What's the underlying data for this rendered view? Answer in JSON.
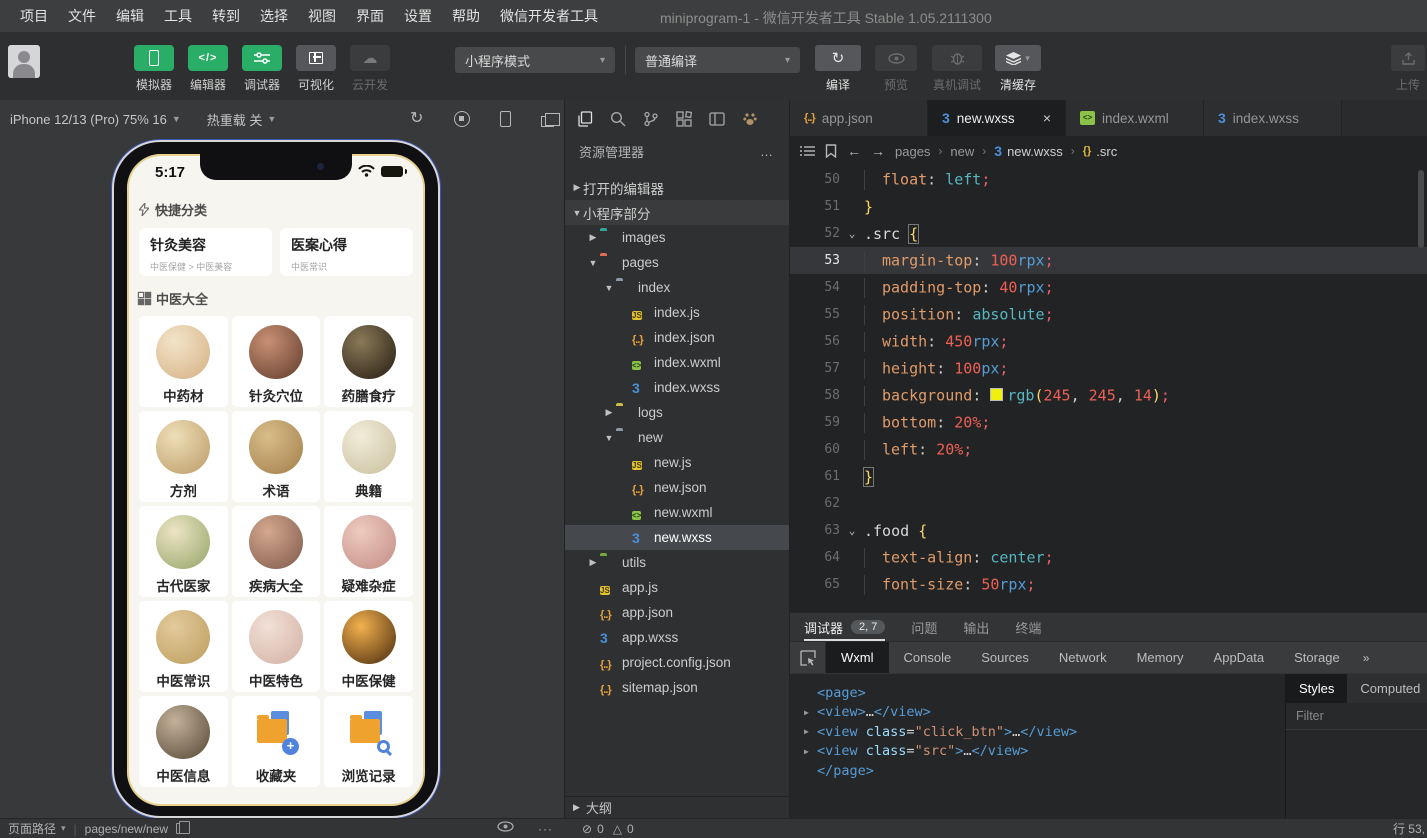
{
  "menu_bar": {
    "items": [
      "项目",
      "文件",
      "编辑",
      "工具",
      "转到",
      "选择",
      "视图",
      "界面",
      "设置",
      "帮助",
      "微信开发者工具"
    ],
    "title": "miniprogram-1 - 微信开发者工具 Stable 1.05.2111300"
  },
  "toolbar": {
    "mode_buttons": [
      {
        "label": "模拟器",
        "icon": "phone-icon",
        "state": "on"
      },
      {
        "label": "编辑器",
        "icon": "code-icon",
        "state": "on"
      },
      {
        "label": "调试器",
        "icon": "sliders-icon",
        "state": "on"
      },
      {
        "label": "可视化",
        "icon": "layout-icon",
        "state": "neutral"
      },
      {
        "label": "云开发",
        "icon": "cloud-icon",
        "state": "disabled"
      }
    ],
    "mode_select": "小程序模式",
    "compile_select": "普通编译",
    "actions": [
      {
        "label": "编译",
        "icon": "refresh-icon",
        "state": "normal"
      },
      {
        "label": "预览",
        "icon": "eye-icon",
        "state": "disabled"
      },
      {
        "label": "真机调试",
        "icon": "bug-icon",
        "state": "disabled"
      },
      {
        "label": "清缓存",
        "icon": "layers-icon",
        "state": "normal"
      }
    ],
    "upload_label": "上传",
    "accent_green": "#2aae67"
  },
  "simulator": {
    "device": "iPhone 12/13 (Pro) 75% 16",
    "hot_reload": "热重载 关",
    "phone": {
      "time": "5:17",
      "section1_title": "快捷分类",
      "quick_cards": [
        {
          "title": "针灸美容",
          "subtitle": "中医保健 > 中医美容"
        },
        {
          "title": "医案心得",
          "subtitle": "中医常识"
        }
      ],
      "section2_title": "中医大全",
      "grid": [
        {
          "label": "中药材",
          "kind": "photo",
          "c1": "#f2e4c9",
          "c2": "#d5b083"
        },
        {
          "label": "针灸穴位",
          "kind": "photo",
          "c1": "#c98f74",
          "c2": "#5f3c2c"
        },
        {
          "label": "药膳食疗",
          "kind": "photo",
          "c1": "#8a7a58",
          "c2": "#241b10"
        },
        {
          "label": "方剂",
          "kind": "photo",
          "c1": "#eedfb8",
          "c2": "#bb9a66"
        },
        {
          "label": "术语",
          "kind": "photo",
          "c1": "#d9bd8a",
          "c2": "#a27e49"
        },
        {
          "label": "典籍",
          "kind": "photo",
          "c1": "#f2ecd9",
          "c2": "#c9bf9d"
        },
        {
          "label": "古代医家",
          "kind": "photo",
          "c1": "#ece5c4",
          "c2": "#94a368"
        },
        {
          "label": "疾病大全",
          "kind": "photo",
          "c1": "#d3a88e",
          "c2": "#7e584a"
        },
        {
          "label": "疑难杂症",
          "kind": "photo",
          "c1": "#eecabf",
          "c2": "#c28d85"
        },
        {
          "label": "中医常识",
          "kind": "photo",
          "c1": "#e2ca9b",
          "c2": "#bd9d5e"
        },
        {
          "label": "中医特色",
          "kind": "photo",
          "c1": "#f2e0d7",
          "c2": "#d2b0a3"
        },
        {
          "label": "中医保健",
          "kind": "photo",
          "c1": "#f2b14e",
          "c2": "#47290c"
        },
        {
          "label": "中医信息",
          "kind": "photo",
          "c1": "#c3b199",
          "c2": "#554735"
        },
        {
          "label": "收藏夹",
          "kind": "folder-plus"
        },
        {
          "label": "浏览记录",
          "kind": "folder-search"
        }
      ]
    }
  },
  "explorer": {
    "title": "资源管理器",
    "more": "…",
    "outline_label": "大纲",
    "tree": [
      {
        "label": "打开的编辑器",
        "indent": 0,
        "arrow": "r",
        "section": true
      },
      {
        "label": "小程序部分",
        "indent": 0,
        "arrow": "d",
        "section": true,
        "shaded": true
      },
      {
        "label": "images",
        "indent": 1,
        "arrow": "r",
        "icon": "folder",
        "color": "#2fa79b"
      },
      {
        "label": "pages",
        "indent": 1,
        "arrow": "d",
        "icon": "folder",
        "color": "#e26d51"
      },
      {
        "label": "index",
        "indent": 2,
        "arrow": "d",
        "icon": "folder",
        "color": "#8a98a8"
      },
      {
        "label": "index.js",
        "indent": 3,
        "icon": "js"
      },
      {
        "label": "index.json",
        "indent": 3,
        "icon": "json"
      },
      {
        "label": "index.wxml",
        "indent": 3,
        "icon": "wxml"
      },
      {
        "label": "index.wxss",
        "indent": 3,
        "icon": "wxss"
      },
      {
        "label": "logs",
        "indent": 2,
        "arrow": "r",
        "icon": "folder",
        "color": "#cdbc45"
      },
      {
        "label": "new",
        "indent": 2,
        "arrow": "d",
        "icon": "folder",
        "color": "#8a98a8"
      },
      {
        "label": "new.js",
        "indent": 3,
        "icon": "js"
      },
      {
        "label": "new.json",
        "indent": 3,
        "icon": "json"
      },
      {
        "label": "new.wxml",
        "indent": 3,
        "icon": "wxml"
      },
      {
        "label": "new.wxss",
        "indent": 3,
        "icon": "wxss",
        "selected": true
      },
      {
        "label": "utils",
        "indent": 1,
        "arrow": "r",
        "icon": "folder",
        "color": "#79a93e"
      },
      {
        "label": "app.js",
        "indent": 1,
        "icon": "js"
      },
      {
        "label": "app.json",
        "indent": 1,
        "icon": "json"
      },
      {
        "label": "app.wxss",
        "indent": 1,
        "icon": "wxss"
      },
      {
        "label": "project.config.json",
        "indent": 1,
        "icon": "json"
      },
      {
        "label": "sitemap.json",
        "indent": 1,
        "icon": "json"
      }
    ]
  },
  "editor": {
    "tabs": [
      {
        "label": "app.json",
        "icon": "json",
        "active": false
      },
      {
        "label": "new.wxss",
        "icon": "wxss",
        "active": true,
        "close": "×"
      },
      {
        "label": "index.wxml",
        "icon": "wxml",
        "active": false
      },
      {
        "label": "index.wxss",
        "icon": "wxss",
        "active": false
      }
    ],
    "breadcrumb": [
      {
        "label": "pages"
      },
      {
        "label": "new"
      },
      {
        "label": "new.wxss",
        "icon": "wxss",
        "hi": true
      },
      {
        "label": ".src",
        "icon": "rule",
        "hi": true
      }
    ],
    "code_lines": [
      {
        "num": "50",
        "indent": 1,
        "tokens": [
          [
            "prop",
            "float"
          ],
          [
            "pn",
            ": "
          ],
          [
            "kw",
            "left"
          ],
          [
            "sm",
            ";"
          ]
        ]
      },
      {
        "num": "51",
        "tokens": [
          [
            "br",
            "}"
          ]
        ]
      },
      {
        "num": "52",
        "fold": true,
        "tokens": [
          [
            "sel",
            ".src "
          ],
          [
            "brx",
            "{"
          ]
        ]
      },
      {
        "num": "53",
        "indent": 1,
        "active": true,
        "tokens": [
          [
            "prop",
            "margin-top"
          ],
          [
            "pn",
            ": "
          ],
          [
            "num",
            "100"
          ],
          [
            "un",
            "rpx"
          ],
          [
            "sm",
            ";"
          ]
        ]
      },
      {
        "num": "54",
        "indent": 1,
        "tokens": [
          [
            "prop",
            "padding-top"
          ],
          [
            "pn",
            ": "
          ],
          [
            "num",
            "40"
          ],
          [
            "un",
            "rpx"
          ],
          [
            "sm",
            ";"
          ]
        ]
      },
      {
        "num": "55",
        "indent": 1,
        "tokens": [
          [
            "prop",
            "position"
          ],
          [
            "pn",
            ": "
          ],
          [
            "kw",
            "absolute"
          ],
          [
            "sm",
            ";"
          ]
        ]
      },
      {
        "num": "56",
        "indent": 1,
        "tokens": [
          [
            "prop",
            "width"
          ],
          [
            "pn",
            ": "
          ],
          [
            "num",
            "450"
          ],
          [
            "un",
            "rpx"
          ],
          [
            "sm",
            ";"
          ]
        ]
      },
      {
        "num": "57",
        "indent": 1,
        "tokens": [
          [
            "prop",
            "height"
          ],
          [
            "pn",
            ": "
          ],
          [
            "num",
            "100"
          ],
          [
            "un",
            "px"
          ],
          [
            "sm",
            ";"
          ]
        ]
      },
      {
        "num": "58",
        "indent": 1,
        "tokens": [
          [
            "prop",
            "background"
          ],
          [
            "pn",
            ": "
          ],
          [
            "sw",
            ""
          ],
          [
            "fn",
            "rgb"
          ],
          [
            "br",
            "("
          ],
          [
            "num",
            "245"
          ],
          [
            "pn",
            ", "
          ],
          [
            "num",
            "245"
          ],
          [
            "pn",
            ", "
          ],
          [
            "num",
            "14"
          ],
          [
            "br",
            ")"
          ],
          [
            "sm",
            ";"
          ]
        ]
      },
      {
        "num": "59",
        "indent": 1,
        "tokens": [
          [
            "prop",
            "bottom"
          ],
          [
            "pn",
            ": "
          ],
          [
            "num",
            "20%"
          ],
          [
            "sm",
            ";"
          ]
        ]
      },
      {
        "num": "60",
        "indent": 1,
        "tokens": [
          [
            "prop",
            "left"
          ],
          [
            "pn",
            ": "
          ],
          [
            "num",
            "20%"
          ],
          [
            "sm",
            ";"
          ]
        ]
      },
      {
        "num": "61",
        "tokens": [
          [
            "brx",
            "}"
          ]
        ]
      },
      {
        "num": "62",
        "tokens": []
      },
      {
        "num": "63",
        "fold": true,
        "tokens": [
          [
            "sel",
            ".food "
          ],
          [
            "br",
            "{"
          ]
        ]
      },
      {
        "num": "64",
        "indent": 1,
        "tokens": [
          [
            "prop",
            "text-align"
          ],
          [
            "pn",
            ": "
          ],
          [
            "kw",
            "center"
          ],
          [
            "sm",
            ";"
          ]
        ]
      },
      {
        "num": "65",
        "indent": 1,
        "tokens": [
          [
            "prop",
            "font-size"
          ],
          [
            "pn",
            ": "
          ],
          [
            "num",
            "50"
          ],
          [
            "un",
            "rpx"
          ],
          [
            "sm",
            ";"
          ]
        ]
      }
    ],
    "swatch_color": "#f0f00e"
  },
  "debugger": {
    "panel_tabs": [
      {
        "label": "调试器",
        "badge": "2, 7",
        "active": true
      },
      {
        "label": "问题"
      },
      {
        "label": "输出"
      },
      {
        "label": "终端"
      }
    ],
    "devtools_tabs": [
      "Wxml",
      "Console",
      "Sources",
      "Network",
      "Memory",
      "AppData",
      "Storage"
    ],
    "devtools_active": "Wxml",
    "devtools_more": "»",
    "wxml_lines": [
      {
        "tokens": [
          [
            "tag",
            "<page>"
          ]
        ]
      },
      {
        "arrow": true,
        "tokens": [
          [
            "tag",
            "<view>"
          ],
          [
            "txt",
            "…"
          ],
          [
            "tag",
            "</view>"
          ]
        ]
      },
      {
        "arrow": true,
        "tokens": [
          [
            "tag",
            "<view"
          ],
          [
            "attr",
            " class"
          ],
          [
            "pn",
            "="
          ],
          [
            "str",
            "\"click_btn\""
          ],
          [
            "tag",
            ">"
          ],
          [
            "txt",
            "…"
          ],
          [
            "tag",
            "</view>"
          ]
        ]
      },
      {
        "arrow": true,
        "tokens": [
          [
            "tag",
            "<view"
          ],
          [
            "attr",
            " class"
          ],
          [
            "pn",
            "="
          ],
          [
            "str",
            "\"src\""
          ],
          [
            "tag",
            ">"
          ],
          [
            "txt",
            "…"
          ],
          [
            "tag",
            "</view>"
          ]
        ]
      },
      {
        "tokens": [
          [
            "tag",
            "</page>"
          ]
        ]
      }
    ],
    "styles_tabs": [
      {
        "label": "Styles",
        "active": true
      },
      {
        "label": "Computed"
      }
    ],
    "filter_placeholder": "Filter"
  },
  "status_bar": {
    "path_label": "页面路径",
    "path_value": "pages/new/new",
    "errors": "0",
    "warnings": "0",
    "line_col": "行 53,"
  }
}
